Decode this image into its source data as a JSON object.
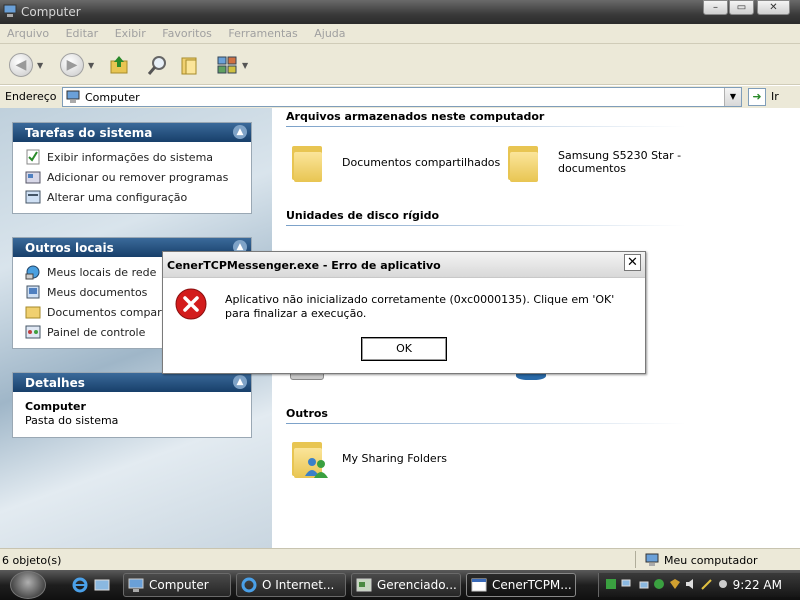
{
  "window": {
    "title": "Computer"
  },
  "menu": [
    "Arquivo",
    "Editar",
    "Exibir",
    "Favoritos",
    "Ferramentas",
    "Ajuda"
  ],
  "address": {
    "label": "Endereço",
    "value": "Computer",
    "go_label": "Ir"
  },
  "left_panels": {
    "system_tasks": {
      "title": "Tarefas do sistema",
      "items": [
        "Exibir informações do sistema",
        "Adicionar ou remover programas",
        "Alterar uma configuração"
      ]
    },
    "other_places": {
      "title": "Outros locais",
      "items": [
        "Meus locais de rede",
        "Meus documentos",
        "Documentos compartilhados",
        "Painel de controle"
      ]
    },
    "details": {
      "title": "Detalhes",
      "name": "Computer",
      "description": "Pasta do sistema"
    }
  },
  "content": {
    "stored_files": {
      "title": "Arquivos armazenados neste computador",
      "items": [
        "Documentos compartilhados",
        "Samsung S5230 Star -",
        "documentos"
      ]
    },
    "hard_disks": {
      "title": "Unidades de disco rígido"
    },
    "others": {
      "title": "Outros",
      "items": [
        "My Sharing Folders"
      ]
    }
  },
  "dialog": {
    "title": "CenerTCPMessenger.exe - Erro de aplicativo",
    "message": "Aplicativo não inicializado corretamente (0xc0000135). Clique em 'OK' para finalizar a execução.",
    "ok_label": "OK"
  },
  "status": {
    "left": "6 objeto(s)",
    "right": "Meu computador"
  },
  "taskbar": {
    "buttons": [
      "Computer",
      "O Internet...",
      "Gerenciado...",
      "CenerTCPM..."
    ],
    "clock": "9:22 AM"
  },
  "colors": {
    "panel_header": "#173f6a",
    "error_red": "#d31c1c",
    "folder_yellow": "#e8c552",
    "taskbar": "#1e1e1e"
  }
}
